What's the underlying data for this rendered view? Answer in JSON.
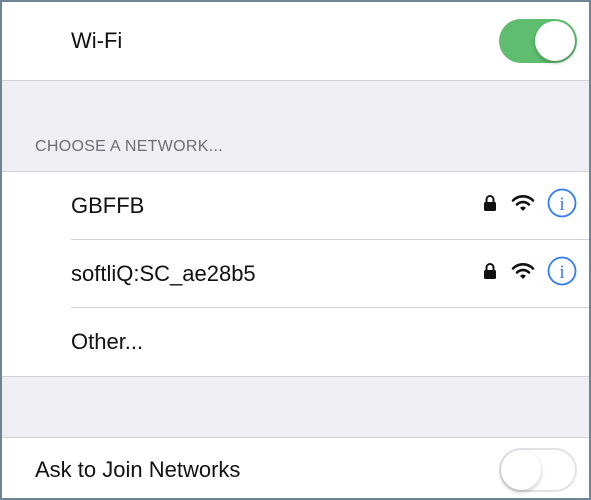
{
  "wifi": {
    "label": "Wi-Fi",
    "enabled": true
  },
  "networks": {
    "section_header": "CHOOSE A NETWORK...",
    "items": [
      {
        "name": "GBFFB",
        "secured": true,
        "icons": [
          "lock-icon",
          "wifi-icon",
          "info-icon"
        ]
      },
      {
        "name": "softliQ:SC_ae28b5",
        "secured": true,
        "icons": [
          "lock-icon",
          "wifi-icon",
          "info-icon"
        ]
      }
    ],
    "other_label": "Other..."
  },
  "ask_to_join": {
    "label": "Ask to Join Networks",
    "enabled": false
  },
  "colors": {
    "toggle_on": "#5ebd6e",
    "info_accent": "#2f7cf6",
    "group_background": "#eeeef3"
  }
}
